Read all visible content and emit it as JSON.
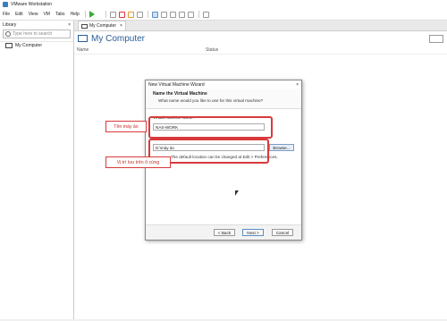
{
  "app": {
    "title": "VMware Workstation"
  },
  "menu": [
    "File",
    "Edit",
    "View",
    "VM",
    "Tabs",
    "Help"
  ],
  "library": {
    "title": "Library",
    "close": "×",
    "search_placeholder": "Type here to search",
    "items": [
      {
        "label": "My Computer"
      }
    ]
  },
  "tab": {
    "label": "My Computer",
    "close": "×"
  },
  "page": {
    "title": "My Computer"
  },
  "columns": {
    "name": "Name",
    "status": "Status"
  },
  "dialog": {
    "title": "New Virtual Machine Wizard",
    "close": "×",
    "heading": "Name the Virtual Machine",
    "subheading": "What name would you like to use for this virtual machine?",
    "vm_name_label": "Virtual machine name:",
    "vm_name_value": "NAS-WORK",
    "location_label": "Location:",
    "location_value": "D:\\máy ảo",
    "browse_label": "Browse...",
    "hint": "The default location can be changed at Edit > Preferences.",
    "back_label": "< Back",
    "next_label": "Next >",
    "cancel_label": "Cancel"
  },
  "annotations": {
    "vm_name": "Tên máy ảo",
    "location": "Vị trí lưu trên ổ cứng",
    "color": "#d83a3a"
  }
}
